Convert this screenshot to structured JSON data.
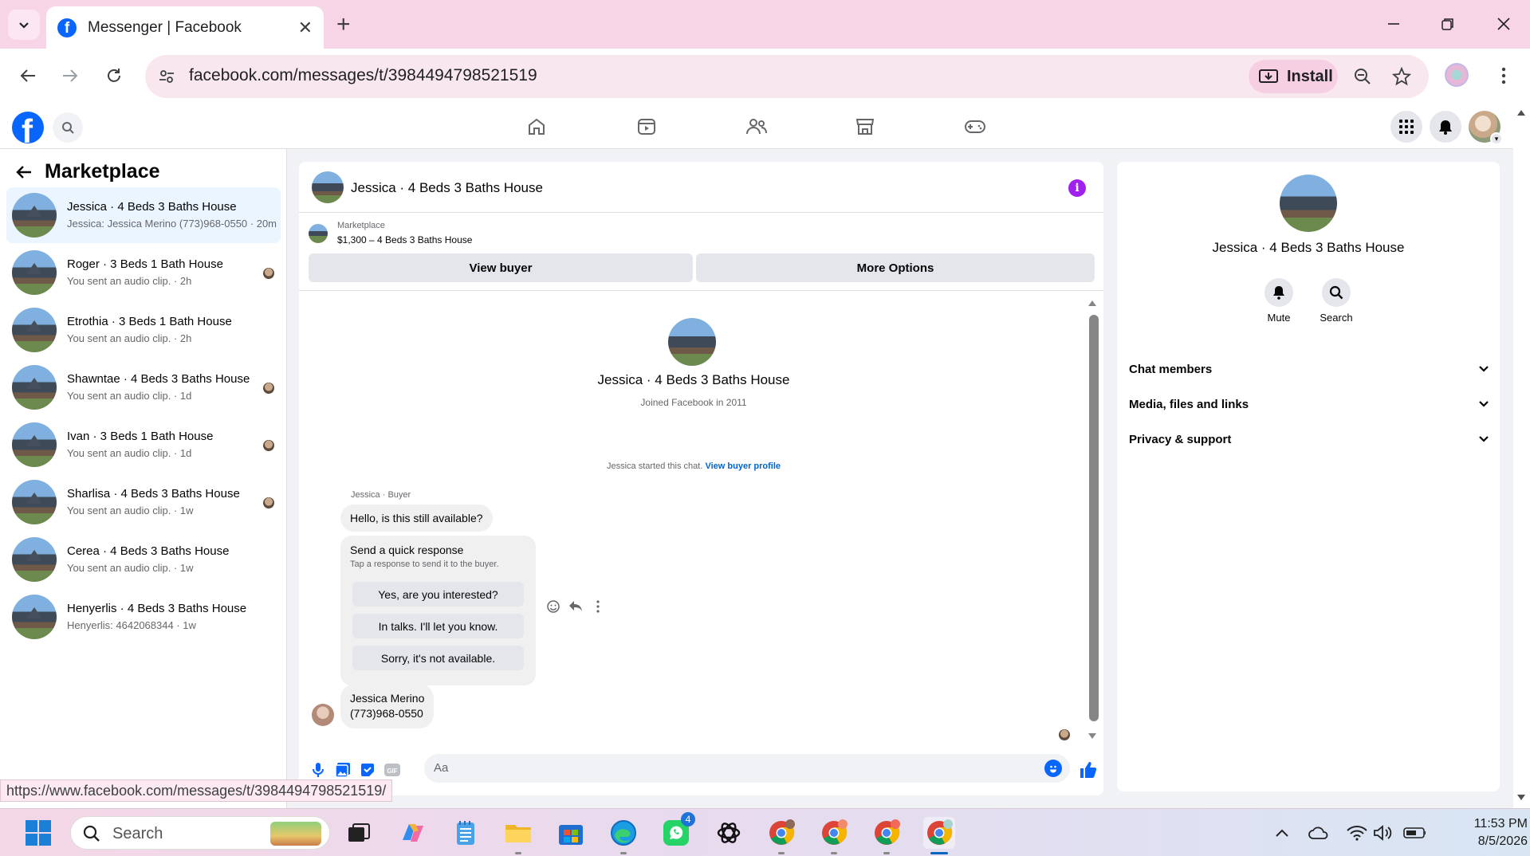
{
  "browser": {
    "tab_title": "Messenger | Facebook",
    "url": "facebook.com/messages/t/3984494798521519",
    "install_label": "Install",
    "status_url": "https://www.facebook.com/messages/t/3984494798521519/"
  },
  "sidebar": {
    "title": "Marketplace",
    "conversations": [
      {
        "name": "Jessica · 4 Beds 3 Baths House",
        "preview": "Jessica: Jessica Merino (773)968-0550 · 20m"
      },
      {
        "name": "Roger · 3 Beds 1 Bath House",
        "preview": "You sent an audio clip. · 2h"
      },
      {
        "name": "Etrothia · 3 Beds 1 Bath House",
        "preview": "You sent an audio clip. · 2h"
      },
      {
        "name": "Shawntae · 4 Beds 3 Baths House",
        "preview": "You sent an audio clip. · 1d"
      },
      {
        "name": "Ivan · 3 Beds 1 Bath House",
        "preview": "You sent an audio clip. · 1d"
      },
      {
        "name": "Sharlisa · 4 Beds 3 Baths House",
        "preview": "You sent an audio clip. · 1w"
      },
      {
        "name": "Cerea · 4 Beds 3 Baths House",
        "preview": "You sent an audio clip. · 1w"
      },
      {
        "name": "Henyerlis · 4 Beds 3 Baths House",
        "preview": "Henyerlis: 4642068344 · 1w"
      }
    ]
  },
  "chat": {
    "title": "Jessica · 4 Beds 3 Baths House",
    "listing_source": "Marketplace",
    "listing": "$1,300 – 4 Beds 3 Baths House",
    "view_buyer": "View buyer",
    "more_options": "More Options",
    "profile_name": "Jessica · 4 Beds 3 Baths House",
    "joined": "Joined Facebook in 2011",
    "started_text": "Jessica started this chat.",
    "started_link": "View buyer profile",
    "sender_label": "Jessica · Buyer",
    "message1": "Hello, is this still available?",
    "quick_title": "Send a quick response",
    "quick_sub": "Tap a response to send it to the buyer.",
    "quick_responses": [
      "Yes, are you interested?",
      "In talks. I'll let you know.",
      "Sorry, it's not available."
    ],
    "message2_line1": "Jessica Merino",
    "message2_line2": "(773)968-0550",
    "composer_placeholder": "Aa"
  },
  "info_panel": {
    "name": "Jessica · 4 Beds 3 Baths House",
    "mute": "Mute",
    "search": "Search",
    "sections": [
      "Chat members",
      "Media, files and links",
      "Privacy & support"
    ]
  },
  "taskbar": {
    "search_label": "Search",
    "whatsapp_badge": "4",
    "time": "11:53 PM",
    "date": "8/5/2026"
  },
  "colors": {
    "facebook_blue": "#0866ff",
    "info_purple": "#a020f0",
    "link_blue": "#0064d1",
    "tab_bar_pink": "#f7d4e6"
  }
}
